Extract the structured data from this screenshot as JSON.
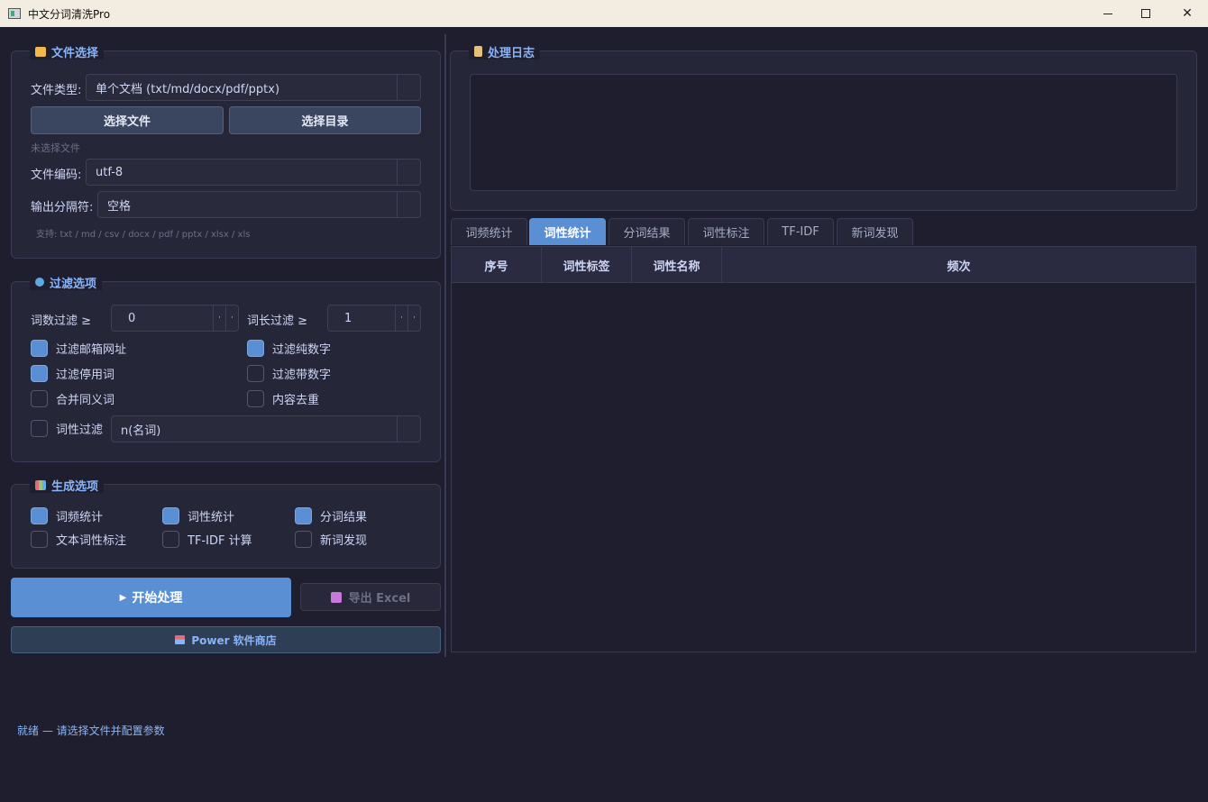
{
  "window": {
    "title": "中文分词清洗Pro",
    "icon": "app-icon",
    "controls": [
      "minimize-icon",
      "maximize-icon",
      "close-icon"
    ]
  },
  "file_select": {
    "title": "文件选择",
    "title_icon": "folder-icon",
    "type_label": "文件类型:",
    "type_value": "单个文档 (txt/md/docx/pdf/pptx)",
    "select_file_label": "选择文件",
    "select_dir_label": "选择目录",
    "no_file_text": "未选择文件",
    "encoding_label": "文件编码:",
    "encoding_value": "utf-8",
    "separator_label": "输出分隔符:",
    "separator_value": "空格",
    "support_text": "支持: txt / md / csv / docx / pdf / pptx / xlsx / xls"
  },
  "filter": {
    "title": "过滤选项",
    "title_icon": "magnifier-icon",
    "freq_label": "词数过滤 ≥",
    "freq_value": "0",
    "len_label": "词长过滤 ≥",
    "len_value": "1",
    "options": [
      {
        "label": "过滤邮箱网址",
        "checked": true
      },
      {
        "label": "过滤纯数字",
        "checked": true
      },
      {
        "label": "过滤停用词",
        "checked": true
      },
      {
        "label": "过滤带数字",
        "checked": false
      },
      {
        "label": "合并同义词",
        "checked": false
      },
      {
        "label": "内容去重",
        "checked": false
      }
    ],
    "pos_filter_label": "词性过滤",
    "pos_filter_checked": false,
    "pos_filter_value": "n(名词)"
  },
  "generate": {
    "title": "生成选项",
    "title_icon": "chart-icon",
    "options": [
      {
        "label": "词频统计",
        "checked": true
      },
      {
        "label": "词性统计",
        "checked": true
      },
      {
        "label": "分词结果",
        "checked": true
      },
      {
        "label": "文本词性标注",
        "checked": false
      },
      {
        "label": "TF-IDF 计算",
        "checked": false
      },
      {
        "label": "新词发现",
        "checked": false
      }
    ]
  },
  "actions": {
    "start_label": "开始处理",
    "start_icon": "play-icon",
    "export_label": "导出 Excel",
    "export_icon": "floppy-disk-icon",
    "store_label": "Power 软件商店",
    "store_icon": "store-icon"
  },
  "log": {
    "title": "处理日志",
    "title_icon": "clipboard-icon"
  },
  "tabs": [
    "词频统计",
    "词性统计",
    "分词结果",
    "词性标注",
    "TF-IDF",
    "新词发现"
  ],
  "active_tab": "词性统计",
  "table": {
    "headers": [
      "序号",
      "词性标签",
      "词性名称",
      "频次"
    ]
  },
  "status": {
    "text": "就绪 — 请选择文件并配置参数"
  },
  "colors": {
    "accent": "#5b8fd4",
    "background": "#1e1e2e",
    "group_title": "#89b4fa"
  }
}
